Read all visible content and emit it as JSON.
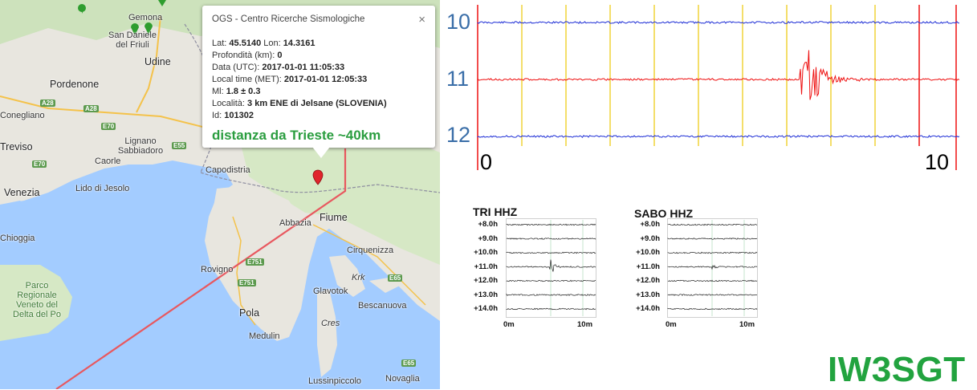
{
  "map": {
    "labels": {
      "gemona": "Gemona",
      "san_daniele": "San Daniele del Friuli",
      "udine": "Udine",
      "pordenone": "Pordenone",
      "conegliano": "Conegliano",
      "treviso": "Treviso",
      "lignano": "Lignano Sabbiadoro",
      "caorle": "Caorle",
      "lido_jesolo": "Lido di Jesolo",
      "venezia": "Venezia",
      "chioggia": "Chioggia",
      "parco": "Parco Regionale Veneto del Delta del Po",
      "capodistria": "Capodistria",
      "abbazia": "Abbazia",
      "fiume": "Fiume",
      "rovigno": "Rovigno",
      "pola": "Pola",
      "medulin": "Medulin",
      "krk": "Krk",
      "glavotok": "Glavotok",
      "cirquenizza": "Cirquenizza",
      "bescanuova": "Bescanuova",
      "cres": "Cres",
      "lussinpiccolo": "Lussinpiccolo",
      "novaglia": "Novaglia"
    },
    "shields": {
      "a28_a": "A28",
      "a28_b": "A28",
      "e70_a": "E70",
      "e70_b": "E70",
      "e55": "E55",
      "e751_a": "E751",
      "e751_b": "E751",
      "e65_a": "E65",
      "e65_b": "E65"
    },
    "colors": {
      "sea": "#a3ccff",
      "land": "#e8e6df",
      "forest": "#cde2bc",
      "route": "#e8585f",
      "marker": "#e0242c"
    }
  },
  "popup": {
    "title": "OGS - Centro Ricerche Sismologiche",
    "close": "×",
    "lat_label": "Lat:",
    "lat": "45.5140",
    "lon_label": "Lon:",
    "lon": "14.3161",
    "depth_label": "Profondità (km):",
    "depth": "0",
    "utc_label": "Data (UTC):",
    "utc": "2017-01-01 11:05:33",
    "local_label": "Local time (MET):",
    "local": "2017-01-01 12:05:33",
    "ml_label": "Ml:",
    "ml": "1.8 ± 0.3",
    "loc_label": "Località:",
    "loc": "3 km ENE di Jelsane (SLOVENIA)",
    "id_label": "Id:",
    "id": "101302",
    "distance_note": "distanza da Trieste ~40km"
  },
  "main_seismogram": {
    "row_labels": [
      "10",
      "11",
      "12"
    ],
    "x_labels": [
      "0",
      "10"
    ],
    "colors": {
      "blue": "#1f2fd6",
      "red": "#ee1111",
      "gridline": "#f0d02a",
      "label": "#3a6ea8"
    }
  },
  "mini_seismograms": [
    {
      "title": "TRI HHZ",
      "rows": [
        "+8.0h",
        "+9.0h",
        "+10.0h",
        "+11.0h",
        "+12.0h",
        "+13.0h",
        "+14.0h"
      ],
      "x_labels": [
        "0m",
        "10m"
      ]
    },
    {
      "title": "SABO HHZ",
      "rows": [
        "+8.0h",
        "+9.0h",
        "+10.0h",
        "+11.0h",
        "+12.0h",
        "+13.0h",
        "+14.0h"
      ],
      "x_labels": [
        "0m",
        "10m"
      ]
    }
  ],
  "brand": "IW3SGT"
}
